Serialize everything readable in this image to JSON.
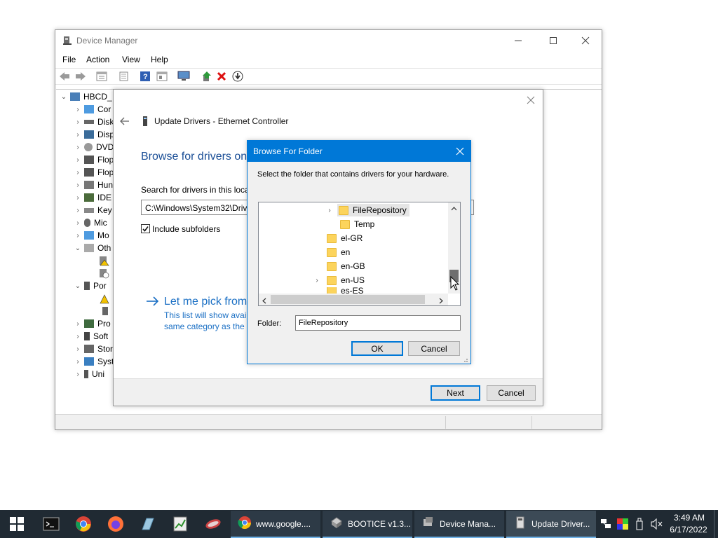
{
  "device_manager": {
    "title": "Device Manager",
    "menu": [
      "File",
      "Action",
      "View",
      "Help"
    ],
    "root": "HBCD_",
    "categories": [
      "Cor",
      "Disk",
      "Disp",
      "DVD",
      "Flop",
      "Flop",
      "Hun",
      "IDE",
      "Key",
      "Mic",
      "Mo",
      "Oth",
      "Por",
      "Pro",
      "Soft",
      "Stor",
      "Syst",
      "Uni"
    ]
  },
  "wizard": {
    "title": "Update Drivers - Ethernet Controller",
    "heading": "Browse for drivers on",
    "search_label": "Search for drivers in this loca",
    "path_value": "C:\\Windows\\System32\\Driv",
    "include_subfolders": "Include subfolders",
    "pick_link": "Let me pick from",
    "pick_desc_1": "This list will show avail",
    "pick_desc_2": "same category as the d",
    "next": "Next",
    "cancel": "Cancel"
  },
  "browse_dialog": {
    "title": "Browse For Folder",
    "instruction": "Select the folder that contains drivers for your hardware.",
    "folders": [
      "FileRepository",
      "Temp",
      "el-GR",
      "en",
      "en-GB",
      "en-US",
      "es-ES"
    ],
    "folder_label": "Folder:",
    "folder_value": "FileRepository",
    "ok": "OK",
    "cancel": "Cancel"
  },
  "taskbar": {
    "buttons": [
      "www.google....",
      "BOOTICE v1.3...",
      "Device Mana...",
      "Update Driver..."
    ],
    "time": "3:49 AM",
    "date": "6/17/2022"
  },
  "colors": {
    "accent": "#0078d7",
    "taskbar": "#202a33",
    "link": "#1a6fc4",
    "folder": "#fcd45c"
  }
}
